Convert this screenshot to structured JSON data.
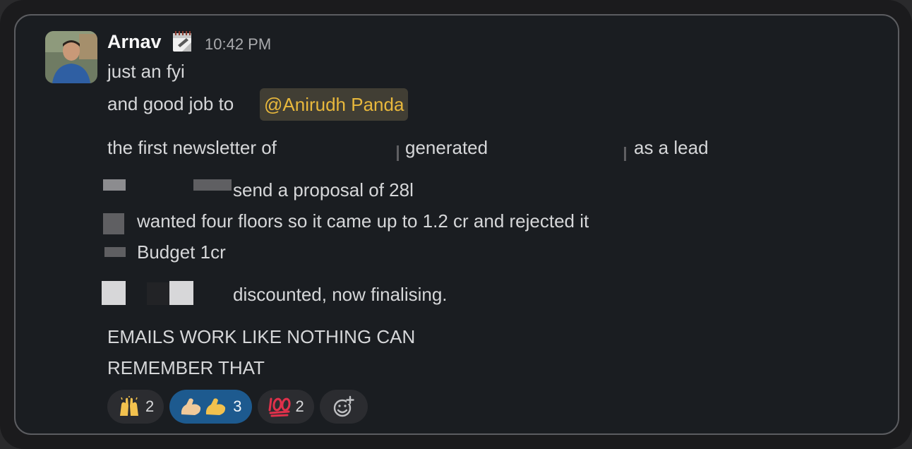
{
  "message": {
    "author": "Arnav",
    "status_icon": "calendar-icon",
    "timestamp": "10:42 PM",
    "lines": {
      "l1": "just an fyi",
      "l2_prefix": "and good job to ",
      "mention": "@Anirudh Panda",
      "l3a": "the first newsletter of",
      "l3b": "generated",
      "l3c": "as a lead",
      "l4": "send a proposal of 28l",
      "l5": "wanted four floors so it came up to 1.2 cr and rejected it",
      "l6": "Budget 1cr",
      "l7": "discounted, now finalising.",
      "l8": "EMAILS WORK LIKE NOTHING CAN",
      "l9": "REMEMBER THAT"
    }
  },
  "reactions": [
    {
      "icon": "raised-hands-icon",
      "count": "2",
      "active": false
    },
    {
      "icon": "flexed-biceps-icon",
      "count": "3",
      "active": true
    },
    {
      "icon": "hundred-points-icon",
      "count": "2",
      "active": false
    },
    {
      "icon": "add-reaction-icon",
      "count": "",
      "active": false
    }
  ],
  "colors": {
    "background": "#1a1d21",
    "text": "#d6d7d9",
    "mention_bg": "#413e34",
    "mention_text": "#e8b83c",
    "active_reaction": "#1d5a8f"
  }
}
